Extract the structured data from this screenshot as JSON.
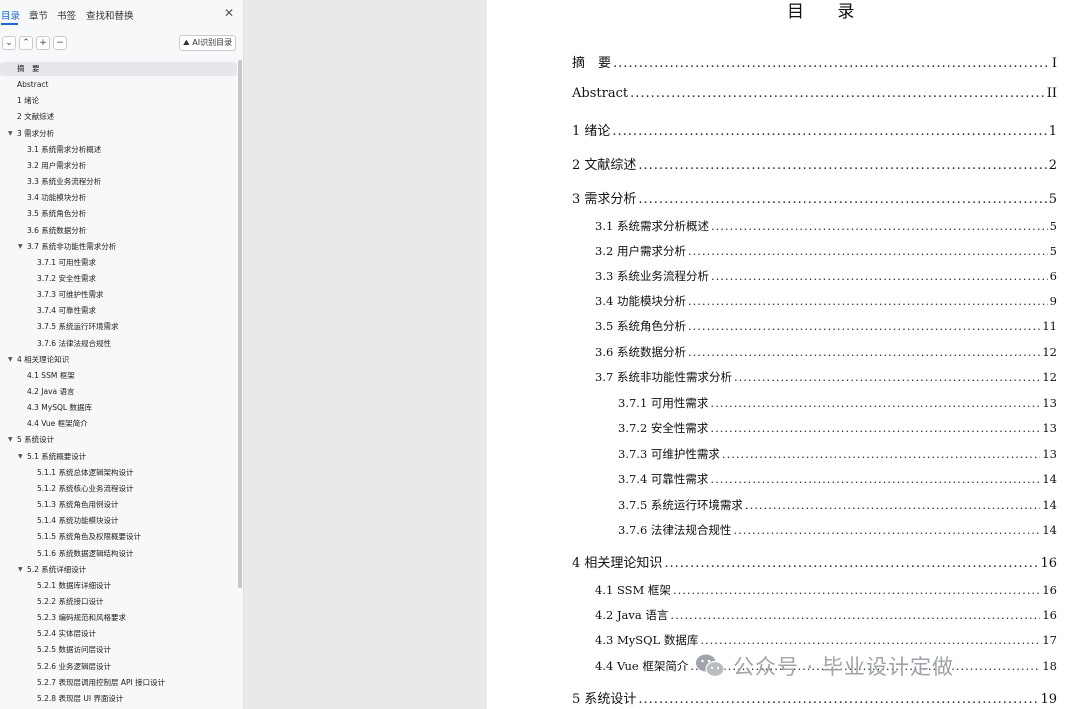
{
  "sidebar": {
    "tabs": [
      "目录",
      "章节",
      "书签",
      "查找和替换"
    ],
    "ai_button": "AI识别目录",
    "items": [
      {
        "label": "摘　要",
        "level": 1,
        "arrow": ""
      },
      {
        "label": "Abstract",
        "level": 1,
        "arrow": ""
      },
      {
        "label": "1 绪论",
        "level": 1,
        "arrow": ""
      },
      {
        "label": "2 文献综述",
        "level": 1,
        "arrow": ""
      },
      {
        "label": "3 需求分析",
        "level": 1,
        "arrow": "▼"
      },
      {
        "label": "3.1 系统需求分析概述",
        "level": 2,
        "arrow": ""
      },
      {
        "label": "3.2 用户需求分析",
        "level": 2,
        "arrow": ""
      },
      {
        "label": "3.3 系统业务流程分析",
        "level": 2,
        "arrow": ""
      },
      {
        "label": "3.4 功能模块分析",
        "level": 2,
        "arrow": ""
      },
      {
        "label": "3.5 系统角色分析",
        "level": 2,
        "arrow": ""
      },
      {
        "label": "3.6 系统数据分析",
        "level": 2,
        "arrow": ""
      },
      {
        "label": "3.7 系统非功能性需求分析",
        "level": 2,
        "arrow": "▼"
      },
      {
        "label": "3.7.1 可用性需求",
        "level": 3,
        "arrow": ""
      },
      {
        "label": "3.7.2 安全性需求",
        "level": 3,
        "arrow": ""
      },
      {
        "label": "3.7.3 可维护性需求",
        "level": 3,
        "arrow": ""
      },
      {
        "label": "3.7.4 可靠性需求",
        "level": 3,
        "arrow": ""
      },
      {
        "label": "3.7.5 系统运行环境需求",
        "level": 3,
        "arrow": ""
      },
      {
        "label": "3.7.6 法律法规合规性",
        "level": 3,
        "arrow": ""
      },
      {
        "label": "4 相关理论知识",
        "level": 1,
        "arrow": "▼"
      },
      {
        "label": "4.1 SSM 框架",
        "level": 2,
        "arrow": ""
      },
      {
        "label": "4.2 Java 语言",
        "level": 2,
        "arrow": ""
      },
      {
        "label": "4.3 MySQL 数据库",
        "level": 2,
        "arrow": ""
      },
      {
        "label": "4.4 Vue 框架简介",
        "level": 2,
        "arrow": ""
      },
      {
        "label": "5 系统设计",
        "level": 1,
        "arrow": "▼"
      },
      {
        "label": "5.1 系统概要设计",
        "level": 2,
        "arrow": "▼"
      },
      {
        "label": "5.1.1 系统总体逻辑架构设计",
        "level": 3,
        "arrow": ""
      },
      {
        "label": "5.1.2 系统核心业务流程设计",
        "level": 3,
        "arrow": ""
      },
      {
        "label": "5.1.3 系统角色用例设计",
        "level": 3,
        "arrow": ""
      },
      {
        "label": "5.1.4 系统功能模块设计",
        "level": 3,
        "arrow": ""
      },
      {
        "label": "5.1.5 系统角色及权限概要设计",
        "level": 3,
        "arrow": ""
      },
      {
        "label": "5.1.6 系统数据逻辑结构设计",
        "level": 3,
        "arrow": ""
      },
      {
        "label": "5.2 系统详细设计",
        "level": 2,
        "arrow": "▼"
      },
      {
        "label": "5.2.1 数据库详细设计",
        "level": 3,
        "arrow": ""
      },
      {
        "label": "5.2.2 系统接口设计",
        "level": 3,
        "arrow": ""
      },
      {
        "label": "5.2.3 编码规范和风格要求",
        "level": 3,
        "arrow": ""
      },
      {
        "label": "5.2.4 实体层设计",
        "level": 3,
        "arrow": ""
      },
      {
        "label": "5.2.5 数据访问层设计",
        "level": 3,
        "arrow": ""
      },
      {
        "label": "5.2.6 业务逻辑层设计",
        "level": 3,
        "arrow": ""
      },
      {
        "label": "5.2.7 表现层调用控制层 API 接口设计",
        "level": 3,
        "arrow": ""
      },
      {
        "label": "5.2.8 表现层 UI 界面设计",
        "level": 3,
        "arrow": ""
      }
    ]
  },
  "document": {
    "title": "目 录",
    "entries": [
      {
        "label": "摘　要",
        "page": "I",
        "level": 1
      },
      {
        "label": "Abstract",
        "page": "II",
        "level": 1
      },
      {
        "label": "1 绪论",
        "page": "1",
        "level": 1
      },
      {
        "label": "2 文献综述",
        "page": "2",
        "level": 1
      },
      {
        "label": "3 需求分析",
        "page": "5",
        "level": 1
      },
      {
        "label": "3.1 系统需求分析概述",
        "page": "5",
        "level": 2
      },
      {
        "label": "3.2 用户需求分析",
        "page": "5",
        "level": 2
      },
      {
        "label": "3.3 系统业务流程分析",
        "page": "6",
        "level": 2
      },
      {
        "label": "3.4 功能模块分析",
        "page": "9",
        "level": 2
      },
      {
        "label": "3.5 系统角色分析",
        "page": "11",
        "level": 2
      },
      {
        "label": "3.6 系统数据分析",
        "page": "12",
        "level": 2
      },
      {
        "label": "3.7 系统非功能性需求分析",
        "page": "12",
        "level": 2
      },
      {
        "label": "3.7.1 可用性需求",
        "page": "13",
        "level": 3
      },
      {
        "label": "3.7.2 安全性需求",
        "page": "13",
        "level": 3
      },
      {
        "label": "3.7.3 可维护性需求",
        "page": "13",
        "level": 3
      },
      {
        "label": "3.7.4 可靠性需求",
        "page": "14",
        "level": 3
      },
      {
        "label": "3.7.5 系统运行环境需求",
        "page": "14",
        "level": 3
      },
      {
        "label": "3.7.6 法律法规合规性",
        "page": "14",
        "level": 3
      },
      {
        "label": "4 相关理论知识",
        "page": "16",
        "level": 1
      },
      {
        "label": "4.1 SSM 框架",
        "page": "16",
        "level": 2
      },
      {
        "label": "4.2 Java 语言",
        "page": "16",
        "level": 2
      },
      {
        "label": "4.3 MySQL 数据库",
        "page": "17",
        "level": 2
      },
      {
        "label": "4.4 Vue 框架简介",
        "page": "18",
        "level": 2
      },
      {
        "label": "5 系统设计",
        "page": "19",
        "level": 1
      }
    ]
  },
  "watermark": "公众号 · 毕业设计定做"
}
